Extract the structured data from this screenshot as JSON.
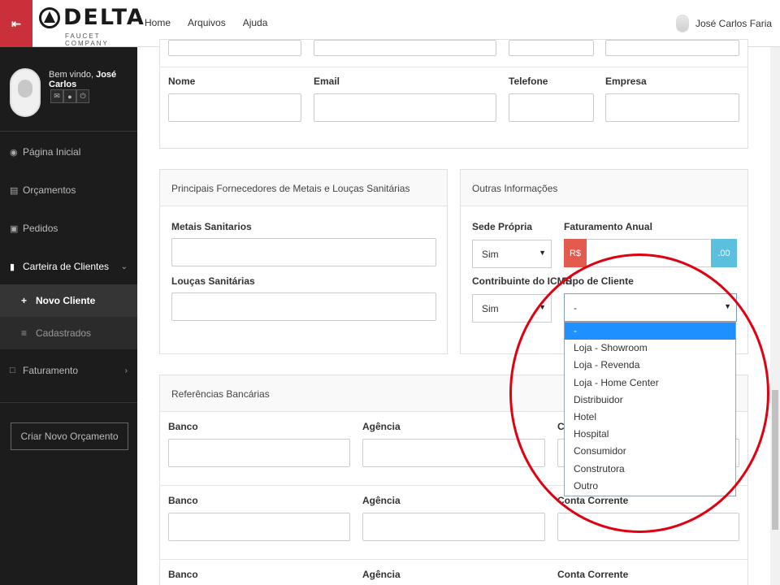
{
  "topbar": {
    "menu_icon": "menu-collapse-icon",
    "logo_text": "DELTA",
    "logo_sub": "FAUCET COMPANY",
    "nav": [
      "Home",
      "Arquivos",
      "Ajuda"
    ],
    "user_name": "José Carlos Faria"
  },
  "sidebar": {
    "welcome_prefix": "Bem vindo,",
    "welcome_name": "José Carlos",
    "profile_icons": [
      "envelope-icon",
      "user-icon",
      "power-icon"
    ],
    "items": [
      {
        "label": "Página Inicial",
        "icon": "dashboard-icon"
      },
      {
        "label": "Orçamentos",
        "icon": "document-icon"
      },
      {
        "label": "Pedidos",
        "icon": "truck-icon"
      },
      {
        "label": "Carteira de Clientes",
        "icon": "book-icon"
      },
      {
        "label": "Faturamento",
        "icon": "money-icon"
      }
    ],
    "subitems": [
      {
        "label": "Novo Cliente",
        "icon": "plus-icon"
      },
      {
        "label": "Cadastrados",
        "icon": "list-icon"
      }
    ],
    "new_quote_label": "Criar Novo Orçamento"
  },
  "contact_row": {
    "labels": [
      "Nome",
      "Email",
      "Telefone",
      "Empresa"
    ]
  },
  "suppliers_panel": {
    "title": "Principais Fornecedores de Metais e Louças Sanitárias",
    "metais_label": "Metais Sanitarios",
    "loucas_label": "Louças Sanitárias"
  },
  "other_panel": {
    "title": "Outras Informações",
    "sede_label": "Sede Própria",
    "sede_value": "Sim",
    "faturamento_label": "Faturamento Anual",
    "currency_prefix": "R$",
    "currency_suffix": ".00",
    "icms_label": "Contribuinte do ICMS",
    "icms_value": "Sim",
    "tipo_label": "Tipo de Cliente",
    "tipo_value": "-",
    "tipo_options": [
      "-",
      "Loja - Showroom",
      "Loja - Revenda",
      "Loja - Home Center",
      "Distribuidor",
      "Hotel",
      "Hospital",
      "Consumidor",
      "Construtora",
      "Outro"
    ]
  },
  "bank_panel": {
    "title": "Referências Bancárias",
    "banco_label": "Banco",
    "agencia_label": "Agência",
    "conta_label": "Conta Corrente",
    "conta_label_partial": "Conta"
  },
  "colors": {
    "accent_red": "#c9303a",
    "sidebar_bg": "#1c1c1c",
    "addon_red": "#e55a4e",
    "addon_blue": "#5bc0de",
    "highlight_blue": "#1e90ff",
    "annotation_red": "#e00010"
  }
}
